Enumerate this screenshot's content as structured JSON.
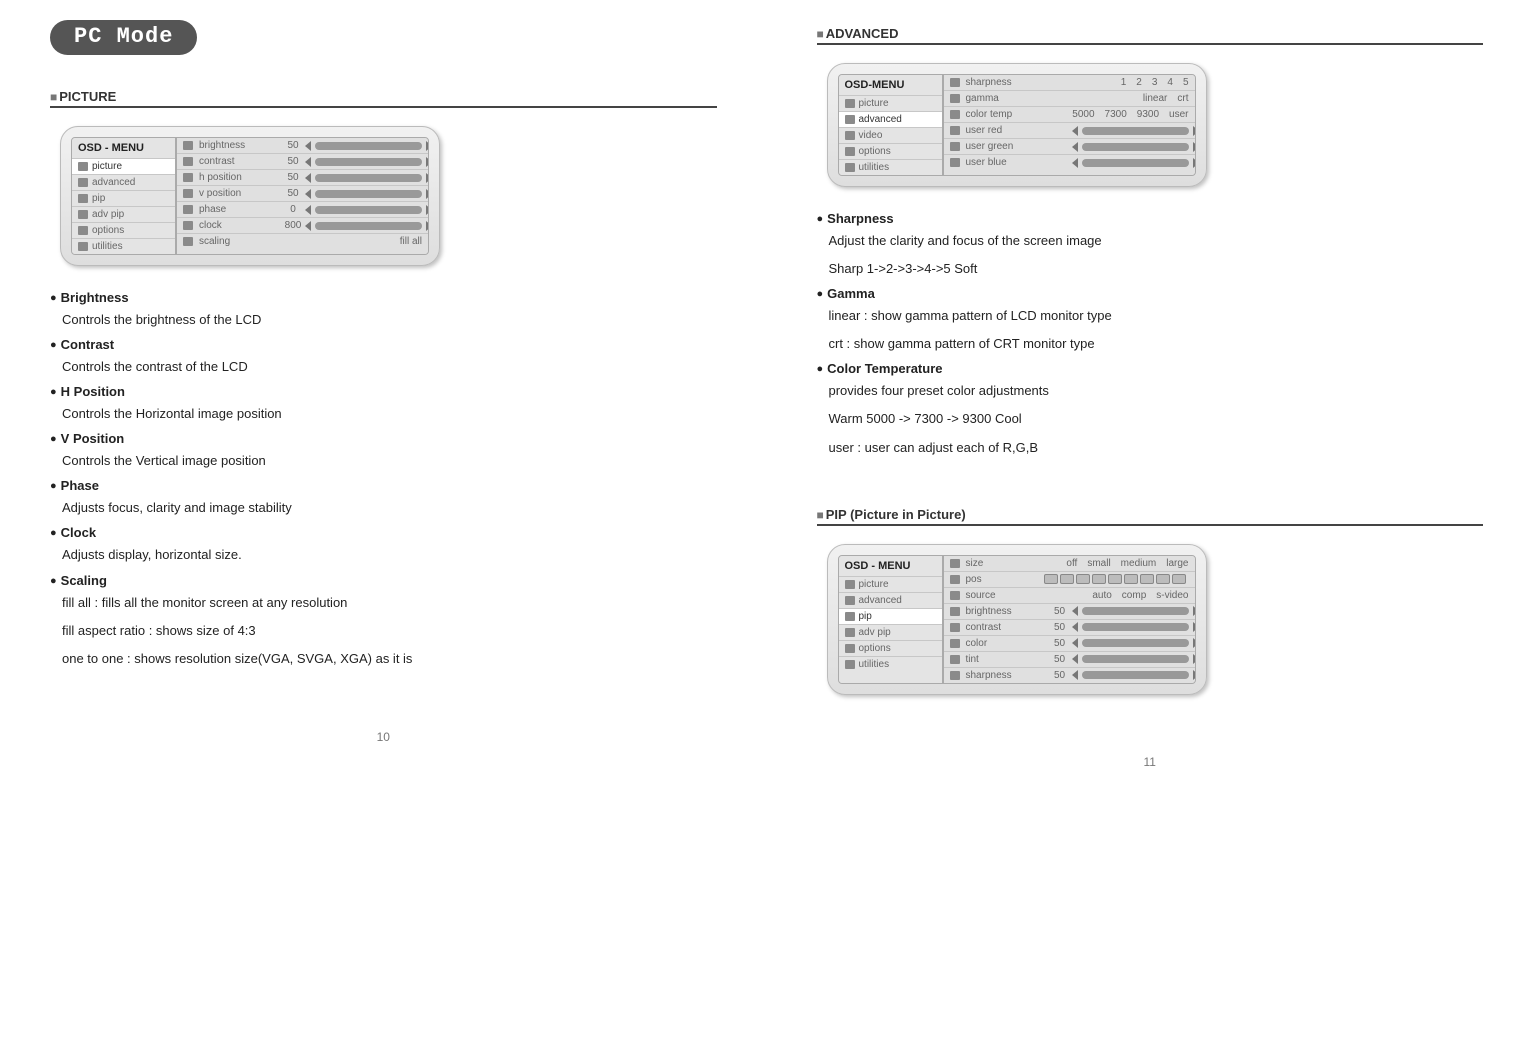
{
  "left": {
    "tab": "PC Mode",
    "section_picture": "PICTURE",
    "osd_picture": {
      "title": "OSD - MENU",
      "menu": [
        "picture",
        "advanced",
        "pip",
        "adv pip",
        "options",
        "utilities"
      ],
      "selected": "picture",
      "rows": [
        {
          "label": "brightness",
          "value": "50",
          "type": "bar"
        },
        {
          "label": "contrast",
          "value": "50",
          "type": "bar"
        },
        {
          "label": "h position",
          "value": "50",
          "type": "bar"
        },
        {
          "label": "v position",
          "value": "50",
          "type": "bar"
        },
        {
          "label": "phase",
          "value": "0",
          "type": "bar"
        },
        {
          "label": "clock",
          "value": "800",
          "type": "bar"
        },
        {
          "label": "scaling",
          "value": "",
          "type": "text",
          "text": "fill all"
        }
      ]
    },
    "items": [
      {
        "name": "Brightness",
        "body": [
          "Controls the brightness of the LCD"
        ]
      },
      {
        "name": "Contrast",
        "body": [
          "Controls the contrast of the LCD"
        ]
      },
      {
        "name": "H Position",
        "body": [
          "Controls the Horizontal image position"
        ]
      },
      {
        "name": "V Position",
        "body": [
          "Controls the Vertical image position"
        ]
      },
      {
        "name": "Phase",
        "body": [
          "Adjusts focus, clarity and image stability"
        ]
      },
      {
        "name": "Clock",
        "body": [
          "Adjusts display, horizontal size."
        ]
      },
      {
        "name": "Scaling",
        "body": [
          "fill all : fills all the monitor screen at any resolution",
          "fill aspect ratio : shows size of 4:3",
          "one to one : shows resolution size(VGA, SVGA, XGA) as it is"
        ]
      }
    ],
    "page_number": "10"
  },
  "right": {
    "section_advanced": "ADVANCED",
    "osd_advanced": {
      "title": "OSD-MENU",
      "menu": [
        "picture",
        "advanced",
        "video",
        "options",
        "utilities"
      ],
      "selected": "advanced",
      "rows": [
        {
          "label": "sharpness",
          "type": "opts",
          "opts": [
            "1",
            "2",
            "3",
            "4",
            "5"
          ]
        },
        {
          "label": "gamma",
          "type": "opts",
          "opts": [
            "linear",
            "crt"
          ]
        },
        {
          "label": "color temp",
          "type": "opts",
          "opts": [
            "5000",
            "7300",
            "9300",
            "user"
          ]
        },
        {
          "label": "user red",
          "value": "",
          "type": "bar"
        },
        {
          "label": "user green",
          "value": "",
          "type": "bar"
        },
        {
          "label": "user blue",
          "value": "",
          "type": "bar"
        }
      ]
    },
    "items_adv": [
      {
        "name": "Sharpness",
        "body": [
          "Adjust the clarity and focus of the screen image",
          "Sharp 1->2->3->4->5 Soft"
        ]
      },
      {
        "name": "Gamma",
        "body": [
          "linear : show gamma pattern of LCD monitor type",
          "crt : show gamma pattern of CRT monitor type"
        ]
      },
      {
        "name": "Color Temperature",
        "body": [
          "provides four preset color adjustments",
          "Warm 5000 -> 7300 -> 9300 Cool",
          "user : user can adjust each of R,G,B"
        ]
      }
    ],
    "section_pip": "PIP (Picture in Picture)",
    "osd_pip": {
      "title": "OSD - MENU",
      "menu": [
        "picture",
        "advanced",
        "pip",
        "adv pip",
        "options",
        "utilities"
      ],
      "selected": "pip",
      "rows": [
        {
          "label": "size",
          "type": "opts",
          "opts": [
            "off",
            "small",
            "medium",
            "large"
          ]
        },
        {
          "label": "pos",
          "type": "boxes",
          "count": 9
        },
        {
          "label": "source",
          "type": "opts",
          "opts": [
            "auto",
            "comp",
            "s-video"
          ]
        },
        {
          "label": "brightness",
          "value": "50",
          "type": "bar"
        },
        {
          "label": "contrast",
          "value": "50",
          "type": "bar"
        },
        {
          "label": "color",
          "value": "50",
          "type": "bar"
        },
        {
          "label": "tint",
          "value": "50",
          "type": "bar"
        },
        {
          "label": "sharpness",
          "value": "50",
          "type": "bar"
        }
      ]
    },
    "page_number": "11"
  }
}
